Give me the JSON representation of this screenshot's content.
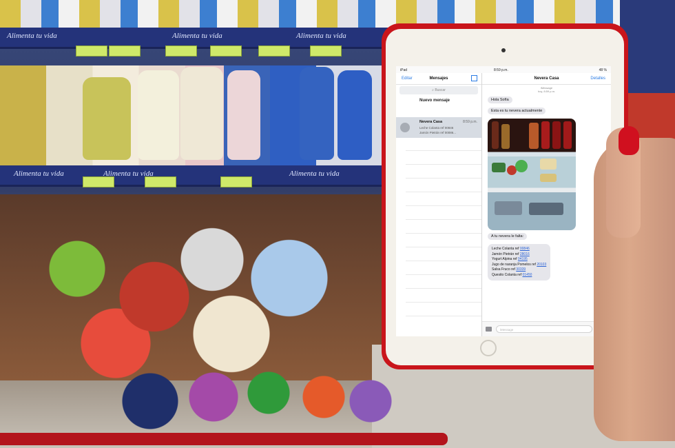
{
  "status_bar": {
    "carrier": "iPad",
    "time": "8:59 p.m.",
    "battery": "48 %"
  },
  "messages_list": {
    "edit_label": "Editar",
    "title": "Mensajes",
    "search_placeholder": "Buscar",
    "new_message_label": "Nuevo mensaje",
    "threads": [
      {
        "name": "Nevera Casa",
        "time": "8:59 p.m.",
        "preview_1": "Leche Colanta ref 00846",
        "preview_2": "Jamón Pietrán ref 00086..."
      }
    ]
  },
  "conversation": {
    "title": "Nevera Casa",
    "details_label": "Detalles",
    "meta_1": "iMessage",
    "meta_2": "hoy, 8:59 p.m.",
    "messages": [
      "Hola Sofía",
      "Esta es tu nevera actualmente",
      "A tu nevera le falta:"
    ],
    "missing_items": [
      {
        "label": "Leche Colanta ref",
        "ref": "00846"
      },
      {
        "label": "Jamón Pietrán ref",
        "ref": "28016"
      },
      {
        "label": "Yogurt Alpina ref",
        "ref": "04195"
      },
      {
        "label": "Jugo de naranja Pomelos ref",
        "ref": "20103"
      },
      {
        "label": "Salsa Fruco ref",
        "ref": "30339"
      },
      {
        "label": "Quesito Colanta ref",
        "ref": "01450"
      }
    ],
    "input_placeholder": "iMessage"
  },
  "shelf_text": {
    "brand_slogan": "Alimenta tu vida"
  },
  "colors": {
    "case": "#c9151b",
    "link": "#2a7be4",
    "shelf_rail": "#24337a",
    "bubble": "#e6e6eb",
    "nail": "#d0101f"
  }
}
